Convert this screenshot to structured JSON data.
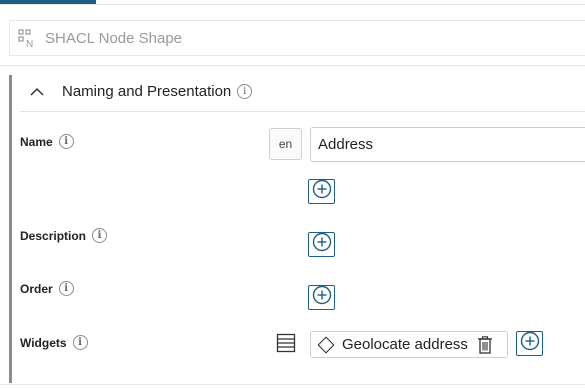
{
  "header": {
    "shape_title": "SHACL Node Shape",
    "shape_icon": "node-shape-icon"
  },
  "group": {
    "title": "Naming and Presentation",
    "expanded": true,
    "info_glyph": "i"
  },
  "properties": {
    "name": {
      "label": "Name",
      "language": "en",
      "value": "Address"
    },
    "description": {
      "label": "Description"
    },
    "order": {
      "label": "Order"
    },
    "widgets": {
      "label": "Widgets",
      "selected_widget": "Geolocate address"
    }
  },
  "colors": {
    "accent": "#1d5f86",
    "left_bar": "#8c8c8c",
    "muted_text": "#9a9a9a"
  }
}
